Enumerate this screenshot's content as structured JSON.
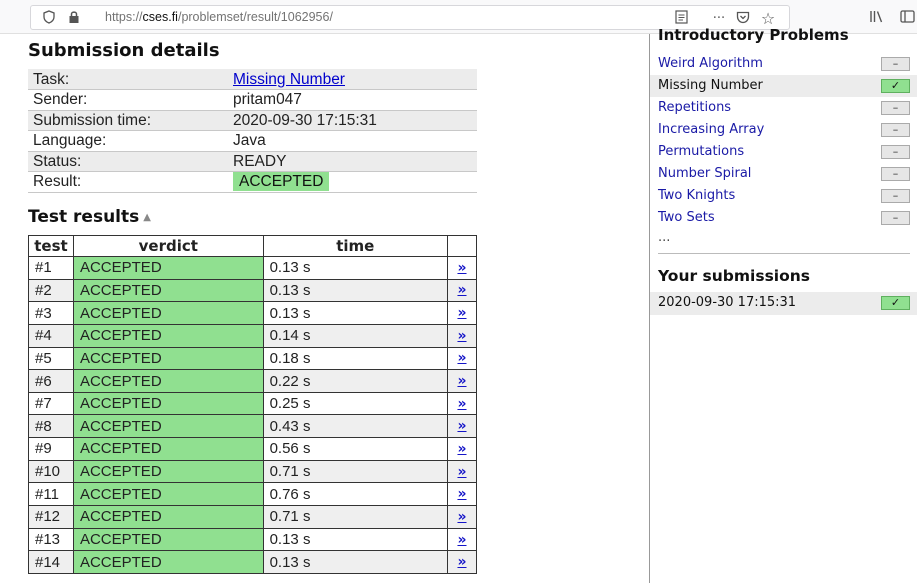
{
  "browser": {
    "url_prefix": "https://",
    "url_host": "cses.fi",
    "url_path": "/problemset/result/1062956/"
  },
  "details": {
    "heading": "Submission details",
    "rows": [
      {
        "label": "Task:",
        "value": "Missing Number"
      },
      {
        "label": "Sender:",
        "value": "pritam047"
      },
      {
        "label": "Submission time:",
        "value": "2020-09-30 17:15:31"
      },
      {
        "label": "Language:",
        "value": "Java"
      },
      {
        "label": "Status:",
        "value": "READY"
      },
      {
        "label": "Result:",
        "value": "ACCEPTED"
      }
    ]
  },
  "tests": {
    "heading": "Test results",
    "columns": [
      "test",
      "verdict",
      "time"
    ],
    "link_glyph": "»",
    "rows": [
      {
        "test": "#1",
        "verdict": "ACCEPTED",
        "time": "0.13 s"
      },
      {
        "test": "#2",
        "verdict": "ACCEPTED",
        "time": "0.13 s"
      },
      {
        "test": "#3",
        "verdict": "ACCEPTED",
        "time": "0.13 s"
      },
      {
        "test": "#4",
        "verdict": "ACCEPTED",
        "time": "0.14 s"
      },
      {
        "test": "#5",
        "verdict": "ACCEPTED",
        "time": "0.18 s"
      },
      {
        "test": "#6",
        "verdict": "ACCEPTED",
        "time": "0.22 s"
      },
      {
        "test": "#7",
        "verdict": "ACCEPTED",
        "time": "0.25 s"
      },
      {
        "test": "#8",
        "verdict": "ACCEPTED",
        "time": "0.43 s"
      },
      {
        "test": "#9",
        "verdict": "ACCEPTED",
        "time": "0.56 s"
      },
      {
        "test": "#10",
        "verdict": "ACCEPTED",
        "time": "0.71 s"
      },
      {
        "test": "#11",
        "verdict": "ACCEPTED",
        "time": "0.76 s"
      },
      {
        "test": "#12",
        "verdict": "ACCEPTED",
        "time": "0.71 s"
      },
      {
        "test": "#13",
        "verdict": "ACCEPTED",
        "time": "0.13 s"
      },
      {
        "test": "#14",
        "verdict": "ACCEPTED",
        "time": "0.13 s"
      }
    ]
  },
  "sidebar": {
    "section_heading": "Introductory Problems",
    "problems": [
      {
        "name": "Weird Algorithm",
        "status": "–",
        "current": false
      },
      {
        "name": "Missing Number",
        "status": "✓",
        "current": true
      },
      {
        "name": "Repetitions",
        "status": "–",
        "current": false
      },
      {
        "name": "Increasing Array",
        "status": "–",
        "current": false
      },
      {
        "name": "Permutations",
        "status": "–",
        "current": false
      },
      {
        "name": "Number Spiral",
        "status": "–",
        "current": false
      },
      {
        "name": "Two Knights",
        "status": "–",
        "current": false
      },
      {
        "name": "Two Sets",
        "status": "–",
        "current": false
      }
    ],
    "more": "...",
    "submissions_heading": "Your submissions",
    "submissions": [
      {
        "time": "2020-09-30 17:15:31",
        "status": "✓"
      }
    ]
  },
  "colors": {
    "accepted": "#90e090",
    "link": "#0000cc"
  }
}
